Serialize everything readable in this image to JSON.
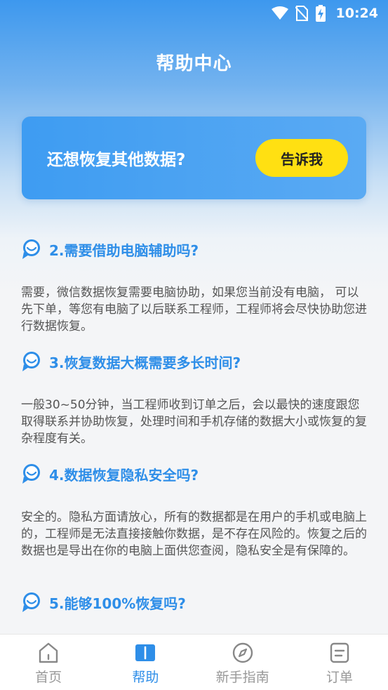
{
  "status_bar": {
    "time": "10:24"
  },
  "header": {
    "title": "帮助中心"
  },
  "banner": {
    "text": "还想恢复其他数据?",
    "button_label": "告诉我"
  },
  "faq": [
    {
      "question": "2.需要借助电脑辅助吗?",
      "answer": "需要，微信数据恢复需要电脑协助，如果您当前没有电脑， 可以先下单，等您有电脑了以后联系工程师，工程师将会尽快协助您进行数据恢复。"
    },
    {
      "question": "3.恢复数据大概需要多长时间?",
      "answer": "一般30~50分钟，当工程师收到订单之后，会以最快的速度跟您取得联系并协助恢复，处理时间和手机存储的数据大小或恢复的复杂程度有关。"
    },
    {
      "question": "4.数据恢复隐私安全吗?",
      "answer": "安全的。隐私方面请放心，所有的数据都是在用户的手机或电脑上的，工程师是无法直接接触你数据，是不存在风险的。恢复之后的数据也是导出在你的电脑上面供您查阅，隐私安全是有保障的。"
    },
    {
      "question": "5.能够100%恢复吗?",
      "answer": ""
    }
  ],
  "tabs": [
    {
      "label": "首页",
      "icon": "home-icon"
    },
    {
      "label": "帮助",
      "icon": "book-icon"
    },
    {
      "label": "新手指南",
      "icon": "compass-icon"
    },
    {
      "label": "订单",
      "icon": "order-icon"
    }
  ],
  "colors": {
    "accent": "#2e8ee8",
    "button": "#ffe012"
  }
}
